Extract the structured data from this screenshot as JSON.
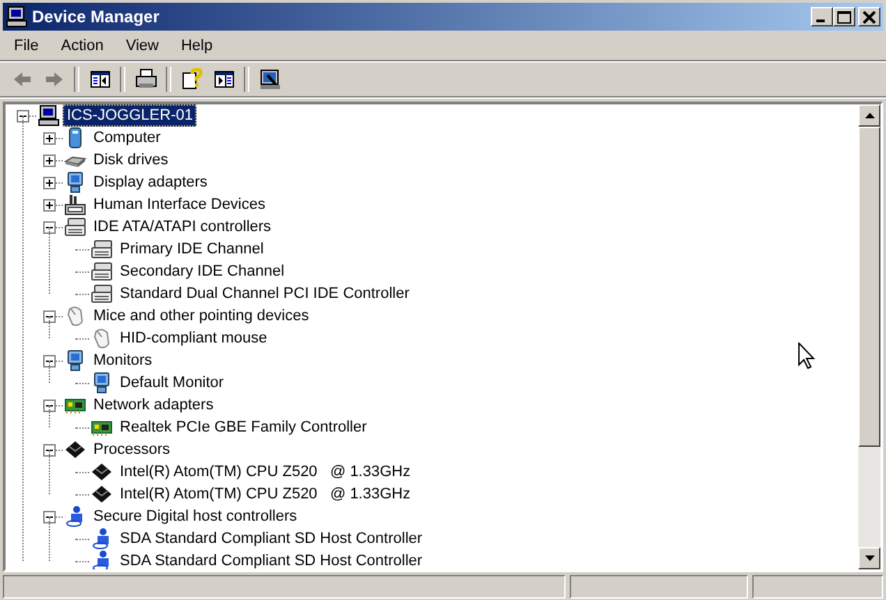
{
  "window": {
    "title": "Device Manager"
  },
  "menu": [
    {
      "label": "File"
    },
    {
      "label": "Action"
    },
    {
      "label": "View"
    },
    {
      "label": "Help"
    }
  ],
  "toolbar": [
    [
      {
        "kind": "back",
        "disabled": true
      },
      {
        "kind": "forward",
        "disabled": true
      }
    ],
    [
      {
        "kind": "tree",
        "disabled": false
      }
    ],
    [
      {
        "kind": "print",
        "disabled": false
      }
    ],
    [
      {
        "kind": "help",
        "disabled": false
      },
      {
        "kind": "pane",
        "disabled": false
      }
    ],
    [
      {
        "kind": "scan",
        "disabled": false
      }
    ]
  ],
  "tree": [
    {
      "label": "ICS-JOGGLER-01",
      "kind": "computer",
      "selected": true,
      "expanded": true,
      "children": [
        {
          "label": "Computer",
          "kind": "pc",
          "selected": false,
          "expanded": false
        },
        {
          "label": "Disk drives",
          "kind": "disk",
          "selected": false,
          "expanded": false
        },
        {
          "label": "Display adapters",
          "kind": "display",
          "selected": false,
          "expanded": false
        },
        {
          "label": "Human Interface Devices",
          "kind": "hid",
          "selected": false,
          "expanded": false
        },
        {
          "label": "IDE ATA/ATAPI controllers",
          "kind": "ide",
          "selected": false,
          "expanded": true,
          "children": [
            {
              "label": "Primary IDE Channel",
              "kind": "ide",
              "selected": false
            },
            {
              "label": "Secondary IDE Channel",
              "kind": "ide",
              "selected": false
            },
            {
              "label": "Standard Dual Channel PCI IDE Controller",
              "kind": "ide",
              "selected": false
            }
          ]
        },
        {
          "label": "Mice and other pointing devices",
          "kind": "mouse",
          "selected": false,
          "expanded": true,
          "children": [
            {
              "label": "HID-compliant mouse",
              "kind": "mouse",
              "selected": false
            }
          ]
        },
        {
          "label": "Monitors",
          "kind": "display",
          "selected": false,
          "expanded": true,
          "children": [
            {
              "label": "Default Monitor",
              "kind": "display",
              "selected": false
            }
          ]
        },
        {
          "label": "Network adapters",
          "kind": "network",
          "selected": false,
          "expanded": true,
          "children": [
            {
              "label": "Realtek PCIe GBE Family Controller",
              "kind": "network",
              "selected": false
            }
          ]
        },
        {
          "label": "Processors",
          "kind": "processor",
          "selected": false,
          "expanded": true,
          "children": [
            {
              "label": "Intel(R) Atom(TM) CPU Z520   @ 1.33GHz",
              "kind": "processor",
              "selected": false
            },
            {
              "label": "Intel(R) Atom(TM) CPU Z520   @ 1.33GHz",
              "kind": "processor",
              "selected": false
            }
          ]
        },
        {
          "label": "Secure Digital host controllers",
          "kind": "sd",
          "selected": false,
          "expanded": true,
          "children": [
            {
              "label": "SDA Standard Compliant SD Host Controller",
              "kind": "sd",
              "selected": false
            },
            {
              "label": "SDA Standard Compliant SD Host Controller",
              "kind": "sd",
              "selected": false
            }
          ]
        }
      ]
    }
  ]
}
